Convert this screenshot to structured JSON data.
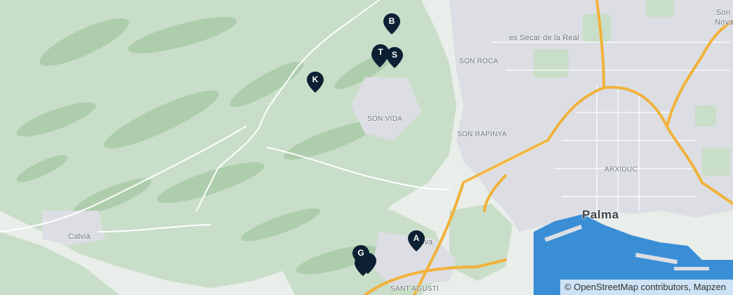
{
  "map": {
    "colors": {
      "land": "#e9eeea",
      "forest": "#c3d9c2",
      "forest_dark": "#9fc39f",
      "urban": "#dcdde2",
      "water": "#3d8fd6",
      "motorway": "#f1b23b",
      "road": "#ffffff",
      "marker": "#0c1f33"
    },
    "places": [
      {
        "id": "palma",
        "label": "Palma",
        "kind": "city"
      },
      {
        "id": "son-vida",
        "label": "SON VIDA",
        "kind": "district"
      },
      {
        "id": "son-roca",
        "label": "SON ROCA",
        "kind": "district"
      },
      {
        "id": "son-rapinya",
        "label": "SON RAPINYA",
        "kind": "district"
      },
      {
        "id": "arxiduc",
        "label": "ARXIDUC",
        "kind": "district"
      },
      {
        "id": "sant-agusti",
        "label": "SANT AGUSTÍ",
        "kind": "district"
      },
      {
        "id": "es-secar",
        "label": "es Secar de la Real",
        "kind": "town"
      },
      {
        "id": "calvia",
        "label": "Calvià",
        "kind": "town"
      },
      {
        "id": "son-nova-1",
        "label": "Son R",
        "kind": "town"
      },
      {
        "id": "son-nova-2",
        "label": "Nova",
        "kind": "town"
      },
      {
        "id": "genova-fragment",
        "label": "ova",
        "kind": "town"
      }
    ],
    "markers": [
      {
        "id": "B",
        "label": "B"
      },
      {
        "id": "T",
        "label": "T"
      },
      {
        "id": "S",
        "label": "S"
      },
      {
        "id": "K",
        "label": "K"
      },
      {
        "id": "A",
        "label": "A"
      },
      {
        "id": "G",
        "label": "G"
      }
    ],
    "attribution": "© OpenStreetMap contributors, Mapzen"
  }
}
